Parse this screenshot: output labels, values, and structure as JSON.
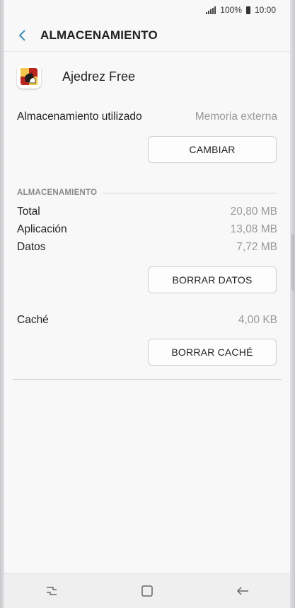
{
  "status_bar": {
    "battery_percent": "100%",
    "time": "10:00",
    "icons": [
      "signal-icon",
      "battery-icon"
    ]
  },
  "app_bar": {
    "title": "ALMACENAMIENTO",
    "back_icon": "back-arrow-icon"
  },
  "app": {
    "name": "Ajedrez Free",
    "icon": "chess-app-icon"
  },
  "storage_used": {
    "label": "Almacenamiento utilizado",
    "value": "Memoria externa",
    "button_label": "CAMBIAR"
  },
  "storage_section": {
    "header": "ALMACENAMIENTO",
    "rows": [
      {
        "label": "Total",
        "value": "20,80 MB"
      },
      {
        "label": "Aplicación",
        "value": "13,08 MB"
      },
      {
        "label": "Datos",
        "value": "7,72 MB"
      }
    ],
    "clear_data_label": "BORRAR DATOS"
  },
  "cache": {
    "label": "Caché",
    "value": "4,00 KB",
    "clear_cache_label": "BORRAR CACHÉ"
  },
  "nav_bar": {
    "icons": [
      "recent-apps-icon",
      "home-icon",
      "back-icon"
    ]
  },
  "colors": {
    "accent": "#3a8fb7",
    "secondary_text": "#9a9a9a"
  }
}
